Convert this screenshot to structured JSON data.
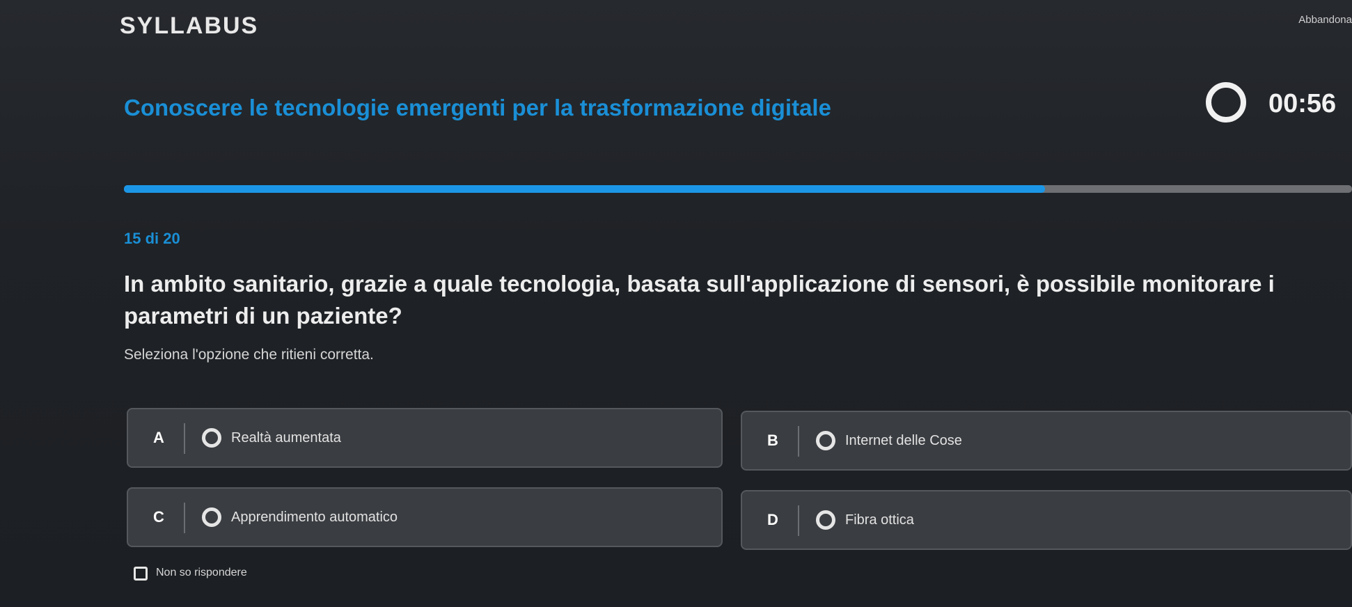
{
  "header": {
    "logo": "SYLLABUS",
    "abandon_label": "Abbandona"
  },
  "course": {
    "title": "Conoscere le tecnologie emergenti per la trasformazione digitale"
  },
  "timer": {
    "value": "00:56"
  },
  "progress": {
    "fraction": 0.75,
    "counter": "15 di 20"
  },
  "question": {
    "text": "In ambito sanitario, grazie a quale tecnologia, basata sull'applicazione di sensori, è possibile monitorare i parametri di un paziente?",
    "instruction": "Seleziona l'opzione che ritieni corretta."
  },
  "options": [
    {
      "letter": "A",
      "text": "Realtà aumentata"
    },
    {
      "letter": "B",
      "text": "Internet delle Cose"
    },
    {
      "letter": "C",
      "text": "Apprendimento automatico"
    },
    {
      "letter": "D",
      "text": "Fibra ottica"
    }
  ],
  "skip": {
    "label": "Non so rispondere"
  },
  "colors": {
    "accent": "#1a8fd6",
    "progress_fill": "#1b96e6",
    "background": "#1f2226",
    "option_bg": "#3a3d41"
  }
}
